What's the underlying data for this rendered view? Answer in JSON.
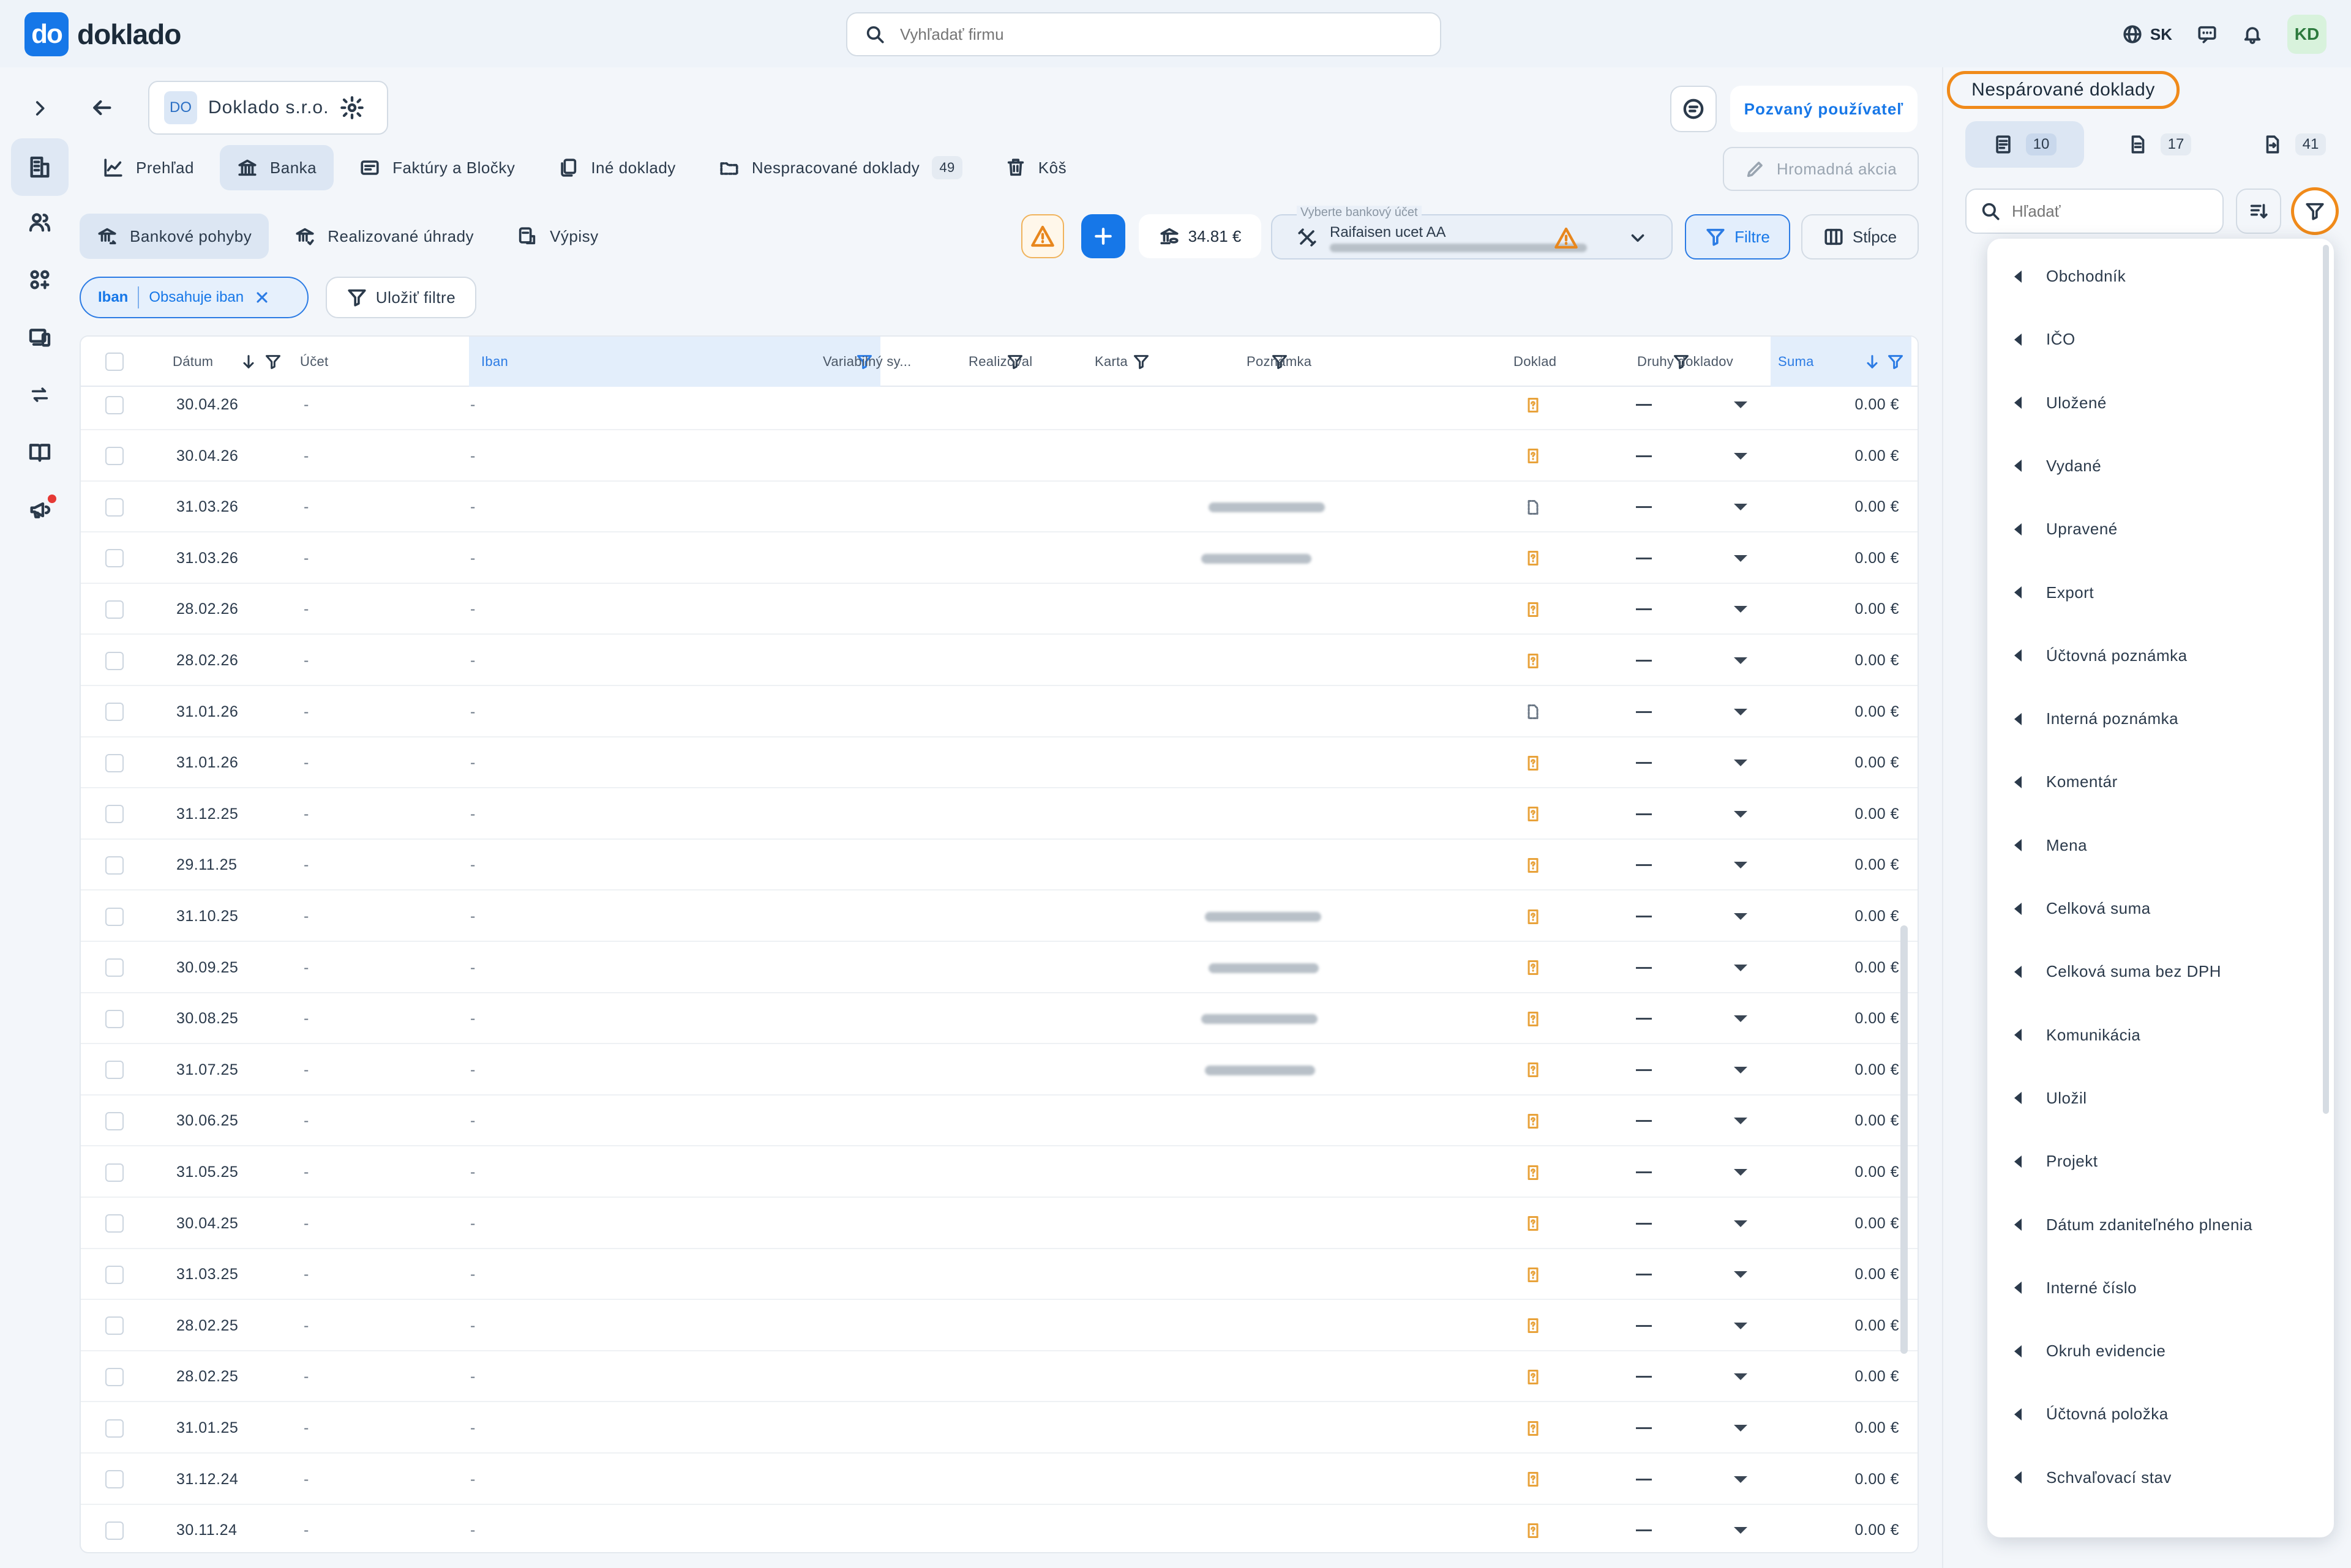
{
  "app": {
    "logo_mark": "do",
    "logo_text": "doklado"
  },
  "topbar": {
    "search_placeholder": "Vyhľadať firmu",
    "language": "SK",
    "avatar": "KD"
  },
  "company": {
    "badge": "DO",
    "name": "Doklado s.r.o."
  },
  "header_actions": {
    "invited_users": "Pozvaný používateľ"
  },
  "main_tabs": [
    {
      "label": "Prehľad"
    },
    {
      "label": "Banka"
    },
    {
      "label": "Faktúry a Bločky"
    },
    {
      "label": "Iné doklady"
    },
    {
      "label": "Nespracované doklady",
      "count": "49"
    },
    {
      "label": "Kôš"
    }
  ],
  "bulk_action": "Hromadná akcia",
  "sub_tabs": [
    {
      "label": "Bankové pohyby"
    },
    {
      "label": "Realizované úhrady"
    },
    {
      "label": "Výpisy"
    }
  ],
  "toolbar": {
    "balance": "34.81 €",
    "account_label": "Vyberte bankový účet",
    "account_value": "Raifaisen ucet AA",
    "filters": "Filtre",
    "columns": "Stĺpce"
  },
  "active_filter": {
    "field": "Iban",
    "condition": "Obsahuje iban"
  },
  "save_filters": "Uložiť filtre",
  "table": {
    "headers": {
      "date": "Dátum",
      "account": "Účet",
      "iban": "Iban",
      "variable_symbol": "Variabilný sy...",
      "realized": "Realizoval",
      "card": "Karta",
      "note": "Poznámka",
      "document": "Doklad",
      "doc_types": "Druhy dokladov",
      "sum": "Suma"
    },
    "rows": [
      {
        "date": "30.04.26",
        "account": "-",
        "iban": "-",
        "note_blur": false,
        "doc": "orange",
        "sum": "0.00 €"
      },
      {
        "date": "30.04.26",
        "account": "-",
        "iban": "-",
        "note_blur": false,
        "doc": "orange",
        "sum": "0.00 €"
      },
      {
        "date": "31.03.26",
        "account": "-",
        "iban": "-",
        "note_blur": true,
        "doc": "gray",
        "sum": "0.00 €"
      },
      {
        "date": "31.03.26",
        "account": "-",
        "iban": "-",
        "note_blur": true,
        "doc": "orange",
        "sum": "0.00 €"
      },
      {
        "date": "28.02.26",
        "account": "-",
        "iban": "-",
        "note_blur": false,
        "doc": "orange",
        "sum": "0.00 €"
      },
      {
        "date": "28.02.26",
        "account": "-",
        "iban": "-",
        "note_blur": false,
        "doc": "orange",
        "sum": "0.00 €"
      },
      {
        "date": "31.01.26",
        "account": "-",
        "iban": "-",
        "note_blur": false,
        "doc": "gray",
        "sum": "0.00 €"
      },
      {
        "date": "31.01.26",
        "account": "-",
        "iban": "-",
        "note_blur": false,
        "doc": "orange",
        "sum": "0.00 €"
      },
      {
        "date": "31.12.25",
        "account": "-",
        "iban": "-",
        "note_blur": false,
        "doc": "orange",
        "sum": "0.00 €"
      },
      {
        "date": "29.11.25",
        "account": "-",
        "iban": "-",
        "note_blur": false,
        "doc": "orange",
        "sum": "0.00 €"
      },
      {
        "date": "31.10.25",
        "account": "-",
        "iban": "-",
        "note_blur": true,
        "doc": "orange",
        "sum": "0.00 €"
      },
      {
        "date": "30.09.25",
        "account": "-",
        "iban": "-",
        "note_blur": true,
        "doc": "orange",
        "sum": "0.00 €"
      },
      {
        "date": "30.08.25",
        "account": "-",
        "iban": "-",
        "note_blur": true,
        "doc": "orange",
        "sum": "0.00 €"
      },
      {
        "date": "31.07.25",
        "account": "-",
        "iban": "-",
        "note_blur": true,
        "doc": "orange",
        "sum": "0.00 €"
      },
      {
        "date": "30.06.25",
        "account": "-",
        "iban": "-",
        "note_blur": false,
        "doc": "orange",
        "sum": "0.00 €"
      },
      {
        "date": "31.05.25",
        "account": "-",
        "iban": "-",
        "note_blur": false,
        "doc": "orange",
        "sum": "0.00 €"
      },
      {
        "date": "30.04.25",
        "account": "-",
        "iban": "-",
        "note_blur": false,
        "doc": "orange",
        "sum": "0.00 €"
      },
      {
        "date": "31.03.25",
        "account": "-",
        "iban": "-",
        "note_blur": false,
        "doc": "orange",
        "sum": "0.00 €"
      },
      {
        "date": "28.02.25",
        "account": "-",
        "iban": "-",
        "note_blur": false,
        "doc": "orange",
        "sum": "0.00 €"
      },
      {
        "date": "28.02.25",
        "account": "-",
        "iban": "-",
        "note_blur": false,
        "doc": "orange",
        "sum": "0.00 €"
      },
      {
        "date": "31.01.25",
        "account": "-",
        "iban": "-",
        "note_blur": false,
        "doc": "orange",
        "sum": "0.00 €"
      },
      {
        "date": "31.12.24",
        "account": "-",
        "iban": "-",
        "note_blur": false,
        "doc": "orange",
        "sum": "0.00 €"
      },
      {
        "date": "30.11.24",
        "account": "-",
        "iban": "-",
        "note_blur": false,
        "doc": "orange",
        "sum": "0.00 €"
      }
    ]
  },
  "right_panel": {
    "title": "Nespárované doklady",
    "tabs": [
      {
        "count": "10",
        "icon": "receipt-icon"
      },
      {
        "count": "17",
        "icon": "document-icon"
      },
      {
        "count": "41",
        "icon": "export-document-icon"
      }
    ],
    "search_placeholder": "Hľadať",
    "filter_fields": [
      "Obchodník",
      "IČO",
      "Uložené",
      "Vydané",
      "Upravené",
      "Export",
      "Účtovná poznámka",
      "Interná poznámka",
      "Komentár",
      "Mena",
      "Celková suma",
      "Celková suma bez DPH",
      "Komunikácia",
      "Uložil",
      "Projekt",
      "Dátum zdaniteľného plnenia",
      "Interné číslo",
      "Okruh evidencie",
      "Účtovná položka",
      "Schvaľovací stav"
    ]
  },
  "colors": {
    "accent": "#1677e8",
    "highlight": "#f08a1a",
    "warning": "#e8871e"
  }
}
